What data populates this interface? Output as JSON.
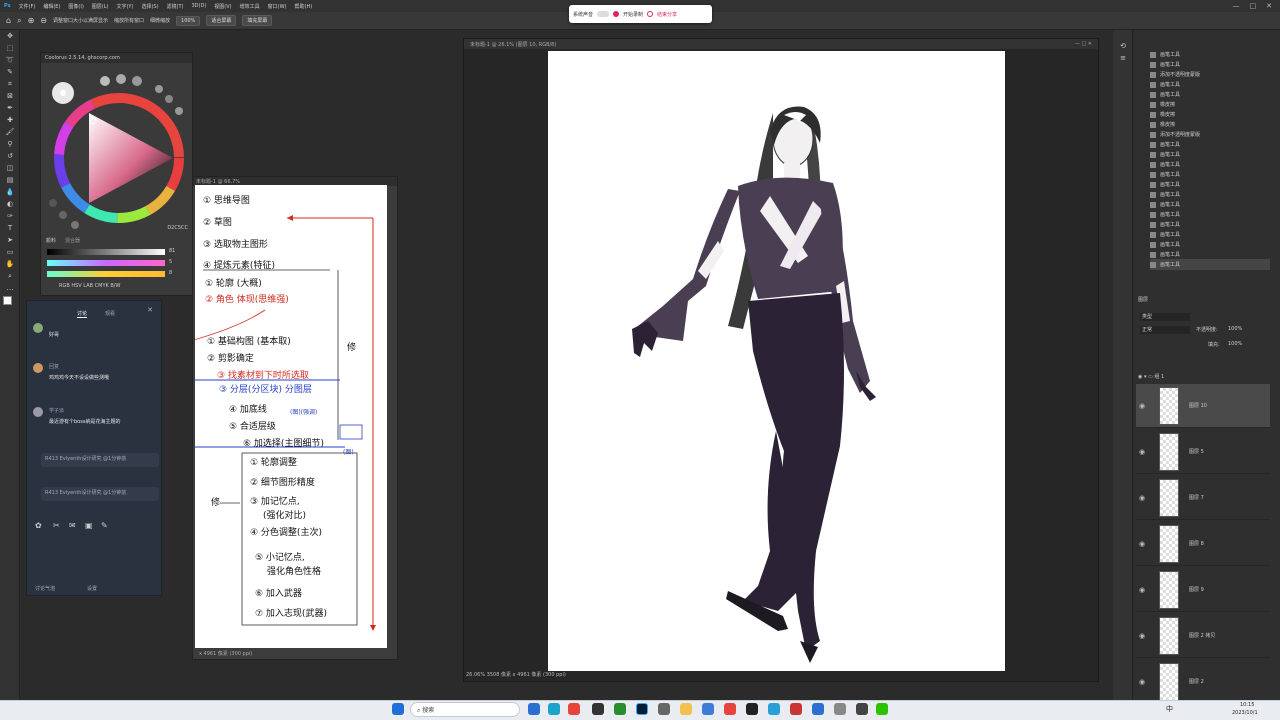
{
  "menubar": {
    "items": [
      "文件(F)",
      "编辑(E)",
      "图像(I)",
      "图层(L)",
      "文字(Y)",
      "选择(S)",
      "滤镜(T)",
      "3D(D)",
      "视图(V)",
      "增效工具",
      "窗口(W)",
      "帮助(H)"
    ],
    "minimize": "—",
    "maximize": "□",
    "close": "✕"
  },
  "options_bar": {
    "resize_label": "调整窗口大小以满屏显示",
    "all_windows_label": "缩放所有窗口",
    "scrubby_label": "细微缩放",
    "zoom_value": "100%",
    "fit_button": "适合屏幕",
    "fill_button": "填充屏幕"
  },
  "recorder": {
    "mic_label": "系统声音",
    "start_label": "开始录制",
    "stop_label": "结束分享"
  },
  "coolorus": {
    "title": "Coolorus 2.5.14, ghscorp.com",
    "tab1": "颜料",
    "tab2": "混合器",
    "hex": "D2C5CC",
    "slider_values": [
      "81",
      "5",
      "8"
    ],
    "modes": "RGB  HSV  LAB  CMYK  B/W"
  },
  "refdoc": {
    "title": "未标题-1 @ 66.7%",
    "status": "x 4961 像素 (300 ppi)",
    "steps": {
      "s1": "① 思维导图",
      "s2": "② 草图",
      "s3": "③ 选取物主图形",
      "s4": "④ 提炼元素(特征)",
      "s5": "① 轮廓 (大概)",
      "s6": "② 角色 体现(思维强)",
      "s7": "① 基础构图 (基本取)",
      "s8": "② 剪影确定",
      "s9": "③ 找素材到下时所选取",
      "s10": "③ 分层(分区块) 分图层",
      "s11": "④ 加底线",
      "s12": "⑤ 合适层级",
      "s13": "⑥ 加选择(主图细节)",
      "s14": "① 轮廓调整",
      "s15": "② 细节图形精度",
      "s16": "③ 加记忆点,",
      "s17": "(强化对比)",
      "s18": "④ 分色调整(主次)",
      "s19": "⑤ 小记忆点,",
      "s20": "强化角色性格",
      "s21": "⑥ 加入武器",
      "s22": "⑦ 加入志现(武器)",
      "side1": "修",
      "side2": "修",
      "note1": "(图)(强调)",
      "note2": "(图)"
    }
  },
  "chat": {
    "tab1": "讨论",
    "tab2": "观看",
    "messages": [
      {
        "name": "",
        "text": "好哥"
      },
      {
        "name": "回复",
        "text": "鸡鸡鸡今天不设设做些测哦"
      },
      {
        "name": "学子派",
        "text": "最近游有个boss纳是花海主题的"
      }
    ],
    "pill1": "R413 Evlyenth设计研究 @1分钟前",
    "pill2": "R413 Evlyenth设计研究 @1分钟前",
    "footer_left": "讨论气泡",
    "footer_right": "设置"
  },
  "document": {
    "title": "未标题-1 @ 26.1% (图层 10, RGB/8)",
    "status": "26.06%   3508 像素 x 4961 像素 (300 ppi)"
  },
  "history": {
    "items": [
      "画笔工具",
      "画笔工具",
      "添加不透明度蒙版",
      "画笔工具",
      "画笔工具",
      "橡皮擦",
      "橡皮擦",
      "橡皮擦",
      "添加不透明度蒙版",
      "画笔工具",
      "画笔工具",
      "画笔工具",
      "画笔工具",
      "画笔工具",
      "画笔工具",
      "画笔工具",
      "画笔工具",
      "画笔工具",
      "画笔工具",
      "画笔工具",
      "画笔工具",
      "画笔工具"
    ]
  },
  "layers": {
    "panel_label": "图层",
    "kind_label": "类型",
    "blend_label": "正常",
    "opacity_label": "不透明度:",
    "opacity_value": "100%",
    "fill_label": "填充:",
    "fill_value": "100%",
    "group_label": "组 1",
    "items": [
      "图层 10",
      "图层 5",
      "图层 7",
      "图层 8",
      "图层 9",
      "图层 2 拷贝",
      "图层 2"
    ]
  },
  "taskbar": {
    "search_placeholder": "搜索",
    "time": "10:15",
    "date": "2023/10/1",
    "lang": "中"
  },
  "colors": {
    "accent_red": "#d42a1e",
    "accent_blue": "#2640c8",
    "figure_dark": "#2c2235",
    "figure_mid": "#4a3e52"
  }
}
